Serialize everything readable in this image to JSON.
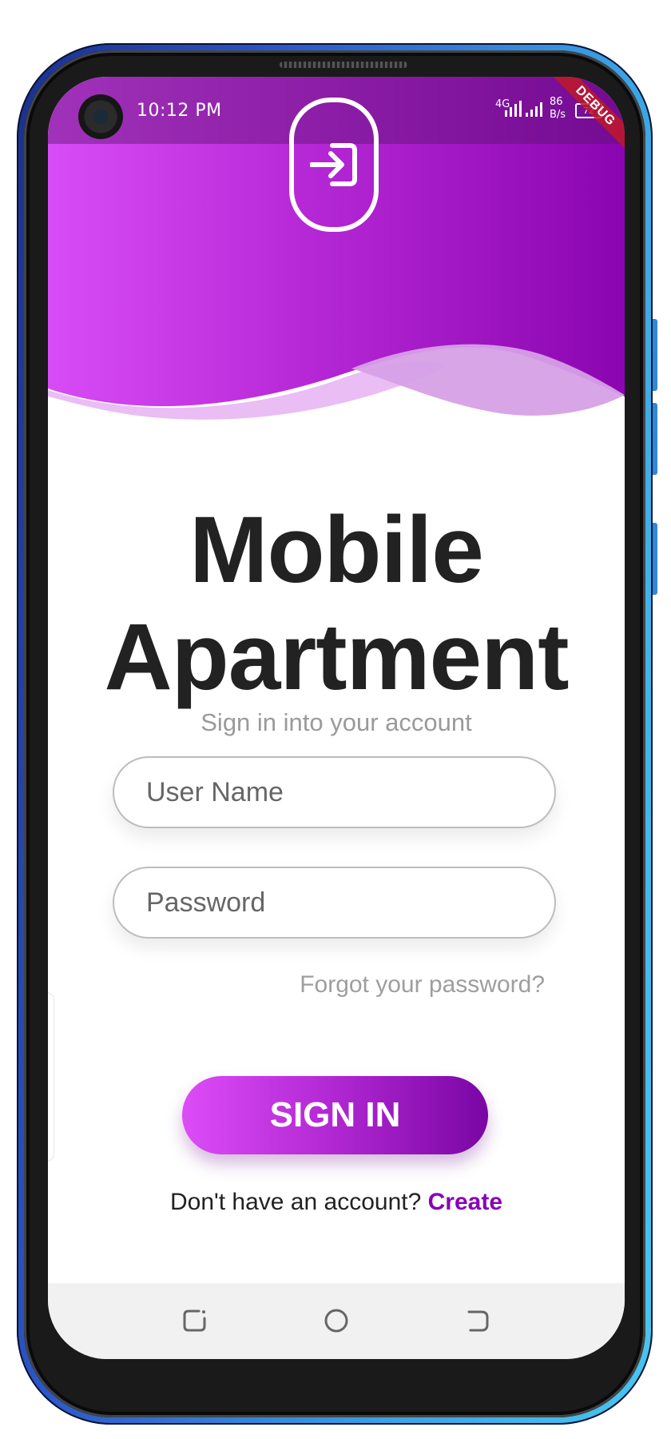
{
  "status_bar": {
    "time": "10:12 PM",
    "network_type": "4G",
    "speed_value": "86",
    "speed_unit": "B/s",
    "battery": "72",
    "debug_label": "DEBUG"
  },
  "header": {
    "icon": "login-icon",
    "colors": {
      "gradient_start": "#d84cf6",
      "gradient_end": "#8a05b0"
    }
  },
  "app": {
    "title_line1": "Mobile",
    "title_line2": "Apartment",
    "subtitle": "Sign in into your account"
  },
  "form": {
    "username_placeholder": "User Name",
    "password_placeholder": "Password",
    "forgot_label": "Forgot your password?",
    "signin_label": "SIGN IN",
    "no_account_text": "Don't have an account?",
    "create_label": "Create"
  },
  "navbar": {
    "buttons": [
      "recent-apps-icon",
      "home-icon",
      "back-icon"
    ]
  }
}
